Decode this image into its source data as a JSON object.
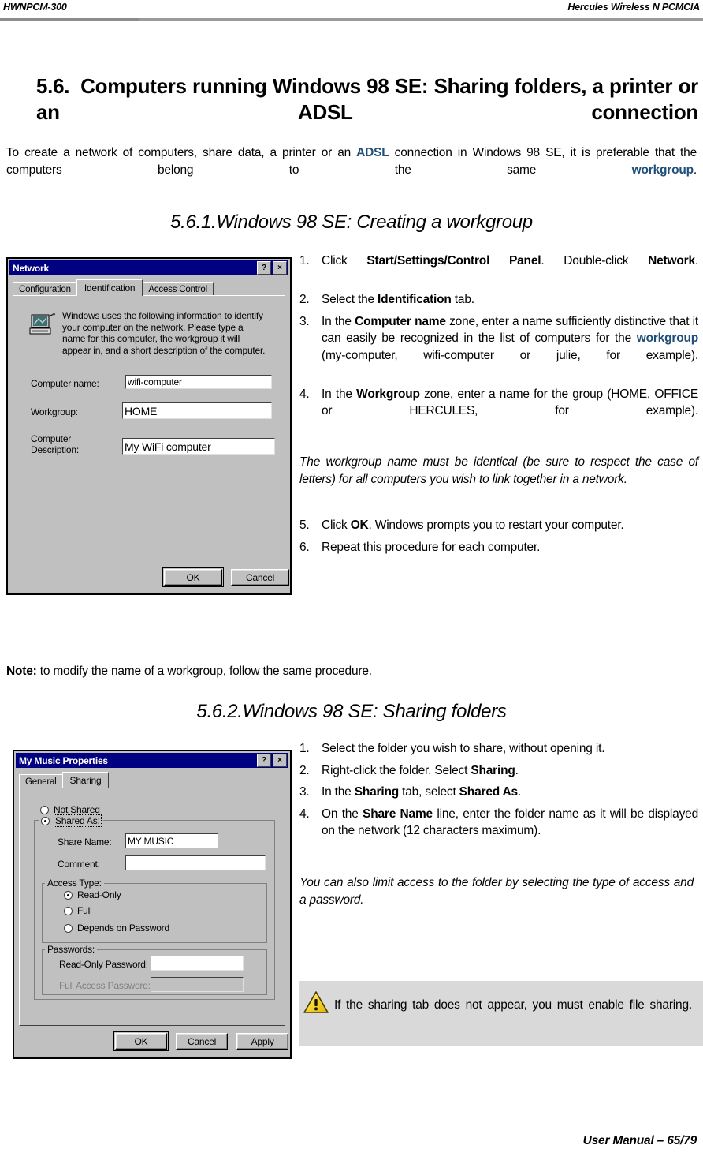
{
  "header": {
    "left": "HWNPCM-300",
    "right": "Hercules Wireless N PCMCIA"
  },
  "footer": {
    "text": "User Manual – 65/79"
  },
  "section": {
    "number": "5.6.",
    "title": "Computers running Windows 98 SE: Sharing folders, a printer or an ADSL connection",
    "intro_1": "To create a network of computers, share data, a printer or an ",
    "intro_adsl": "ADSL",
    "intro_2": " connection in Windows 98 SE, it is preferable that the computers belong to the same ",
    "intro_workgroup": "workgroup",
    "intro_3": "."
  },
  "subsection_1": {
    "heading": "5.6.1.Windows 98 SE: Creating a workgroup",
    "steps": [
      {
        "marker": "1.",
        "parts": [
          {
            "t": "Click ",
            "b": false
          },
          {
            "t": "Start/Settings/Control Panel",
            "b": true
          },
          {
            "t": ".  Double-click ",
            "b": false
          },
          {
            "t": "Network",
            "b": true
          },
          {
            "t": ".",
            "b": false
          }
        ]
      },
      {
        "marker": "2.",
        "parts": [
          {
            "t": "Select the ",
            "b": false
          },
          {
            "t": "Identification",
            "b": true
          },
          {
            "t": " tab.",
            "b": false
          }
        ]
      },
      {
        "marker": "3.",
        "parts": [
          {
            "t": "In the ",
            "b": false
          },
          {
            "t": "Computer name",
            "b": true
          },
          {
            "t": " zone, enter a name sufficiently distinctive that it can easily be recognized in the list of computers for the ",
            "b": false
          },
          {
            "t": "workgroup",
            "b": true,
            "blue": true
          },
          {
            "t": " (my-computer, wifi-computer or julie, for example).",
            "b": false
          }
        ]
      },
      {
        "marker": "4.",
        "parts": [
          {
            "t": "In the ",
            "b": false
          },
          {
            "t": "Workgroup",
            "b": true
          },
          {
            "t": " zone, enter a name for the group (HOME, OFFICE or HERCULES, for example).",
            "b": false
          }
        ]
      }
    ],
    "italic_note": "The workgroup name must be identical (be sure to respect the case of letters) for all computers you wish to link together in a network.",
    "steps_cont": [
      {
        "marker": "5.",
        "parts": [
          {
            "t": "Click ",
            "b": false
          },
          {
            "t": "OK",
            "b": true
          },
          {
            "t": ".  Windows prompts you to restart your computer.",
            "b": false
          }
        ]
      },
      {
        "marker": "6.",
        "parts": [
          {
            "t": "Repeat this procedure for each computer.",
            "b": false
          }
        ]
      }
    ],
    "note_label": "Note:",
    "note_text": " to modify the name of a workgroup, follow the same procedure."
  },
  "subsection_2": {
    "heading": "5.6.2.Windows 98 SE: Sharing folders",
    "steps": [
      {
        "marker": "1.",
        "parts": [
          {
            "t": "Select the folder you wish to share, without opening it.",
            "b": false
          }
        ]
      },
      {
        "marker": "2.",
        "parts": [
          {
            "t": "Right-click the folder.  Select ",
            "b": false
          },
          {
            "t": "Sharing",
            "b": true
          },
          {
            "t": ".",
            "b": false
          }
        ]
      },
      {
        "marker": "3.",
        "parts": [
          {
            "t": "In the ",
            "b": false
          },
          {
            "t": "Sharing",
            "b": true
          },
          {
            "t": " tab, select ",
            "b": false
          },
          {
            "t": "Shared As",
            "b": true
          },
          {
            "t": ".",
            "b": false
          }
        ]
      },
      {
        "marker": "4.",
        "parts": [
          {
            "t": "On the ",
            "b": false
          },
          {
            "t": "Share Name",
            "b": true
          },
          {
            "t": " line, enter the folder name as it will be displayed on the network (12 characters maximum).",
            "b": false
          }
        ]
      }
    ],
    "italic_note": "You can also limit access to the folder by selecting the type of access and a password.",
    "warning_text": "If the sharing tab does not appear, you must enable file sharing.",
    "warning_icon": "warning-triangle-icon"
  },
  "network_dialog": {
    "title": "Network",
    "help_button": "?",
    "close_button": "×",
    "tabs": [
      {
        "label": "Configuration",
        "active": false
      },
      {
        "label": "Identification",
        "active": true
      },
      {
        "label": "Access Control",
        "active": false
      }
    ],
    "icon": "computer-network-icon",
    "description": "Windows uses the following information to identify your computer on the network.  Please type a name for this computer, the workgroup it will appear in, and a short description of the computer.",
    "fields": [
      {
        "label": "Computer name:",
        "value": "wifi-computer"
      },
      {
        "label": "Workgroup:",
        "value": "HOME"
      },
      {
        "label": "Computer Description:",
        "value": "My WiFi computer"
      }
    ],
    "buttons": [
      {
        "label": "OK",
        "default": true
      },
      {
        "label": "Cancel",
        "default": false
      }
    ]
  },
  "properties_dialog": {
    "title": "My Music Properties",
    "help_button": "?",
    "close_button": "×",
    "tabs": [
      {
        "label": "General",
        "active": false
      },
      {
        "label": "Sharing",
        "active": true
      }
    ],
    "share_options": [
      {
        "label": "Not Shared",
        "checked": false
      },
      {
        "label": "Shared As:",
        "checked": true
      }
    ],
    "share_name_label": "Share Name:",
    "share_name_value": "MY MUSIC",
    "comment_label": "Comment:",
    "comment_value": "",
    "access_type_label": "Access Type:",
    "access_types": [
      {
        "label": "Read-Only",
        "checked": true
      },
      {
        "label": "Full",
        "checked": false
      },
      {
        "label": "Depends on Password",
        "checked": false
      }
    ],
    "passwords_label": "Passwords:",
    "passwords": [
      {
        "label": "Read-Only Password:",
        "value": "",
        "disabled": false
      },
      {
        "label": "Full Access Password:",
        "value": "",
        "disabled": true
      }
    ],
    "buttons": [
      {
        "label": "OK",
        "default": true
      },
      {
        "label": "Cancel",
        "default": false
      },
      {
        "label": "Apply",
        "default": false
      }
    ]
  }
}
